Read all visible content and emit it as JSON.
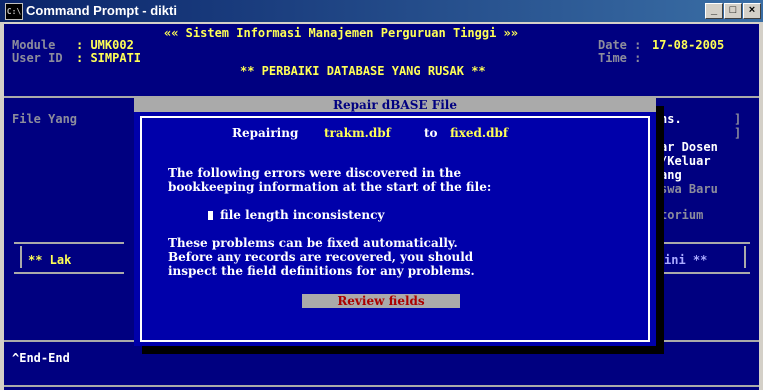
{
  "window": {
    "title": "Command Prompt - dikti",
    "icon": "cmd-icon",
    "minimize": "_",
    "maximize": "□",
    "close": "×"
  },
  "header": {
    "system_title": "«« Sistem Informasi Manajemen Perguruan Tinggi »»",
    "module_label": "Module",
    "module_value": ": UMK002",
    "user_label": "User ID",
    "user_value": ": SIMPATI",
    "date_label": "Date :",
    "date_value": "17-08-2005",
    "time_label": "Time :",
    "screen_title": "** PERBAIKI DATABASE YANG RUSAK **"
  },
  "background_fields": {
    "file_label": "File Yang",
    "right_items": [
      "hs.",
      "ar Dosen",
      "/Keluar",
      "ang",
      "swa Baru",
      "torium"
    ],
    "left_menu": "** Lak",
    "right_menu": "ini **",
    "footer_hint": "^End-End"
  },
  "dialog": {
    "title": "Repair dBASE File",
    "repair_prefix": "Repairing",
    "source_file": "trakm.dbf",
    "repair_to": "to",
    "target_file": "fixed.dbf",
    "errors_line1": "The following errors were discovered in the",
    "errors_line2": "bookkeeping information at the start of the file:",
    "error_item": "file length inconsistency",
    "fix_line1": "These problems can be fixed automatically.",
    "fix_line2": "Before any records are recovered, you should",
    "fix_line3": "inspect the field definitions for any problems.",
    "review_button": "Review fields"
  }
}
